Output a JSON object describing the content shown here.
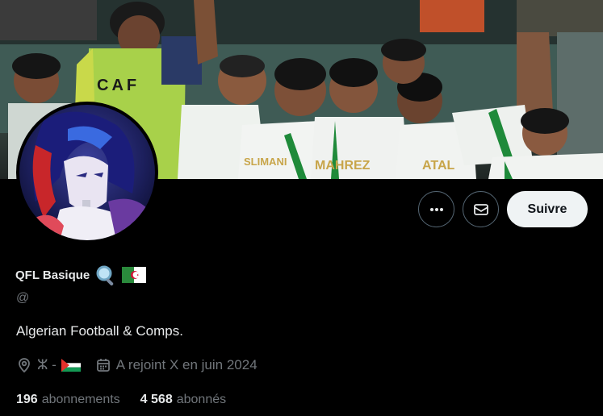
{
  "banner": {
    "bib_text": "CAF",
    "jersey_names": [
      "SLIMANI",
      "MAHREZ",
      "ATAL"
    ]
  },
  "profile": {
    "display_name": "QFL Basique",
    "name_emojis": [
      "magnifying-glass-emoji",
      "algeria-flag-emoji"
    ],
    "handle": "@",
    "bio": "Algerian Football & Comps.",
    "location_text": "ⵣ -",
    "location_flag": "palestine-flag-emoji",
    "joined": "A rejoint X en juin 2024",
    "following_count": "196",
    "following_label": "abonnements",
    "followers_count": "4 568",
    "followers_label": "abonnés"
  },
  "actions": {
    "more_icon": "more-dots-icon",
    "message_icon": "envelope-icon",
    "follow_label": "Suivre"
  },
  "colors": {
    "background": "#000000",
    "primary_text": "#e7e9ea",
    "secondary_text": "#71767b",
    "button_border": "#536471",
    "follow_bg": "#eff3f4"
  }
}
